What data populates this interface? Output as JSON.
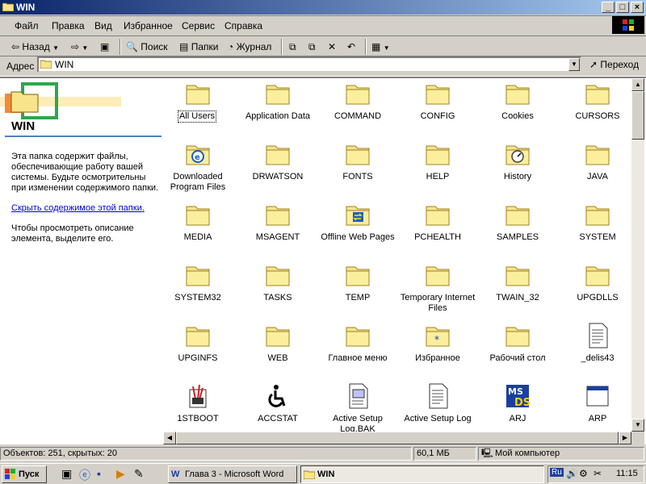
{
  "window": {
    "title": "WIN",
    "min": "_",
    "max": "□",
    "close": "×"
  },
  "menu": {
    "items": [
      {
        "label": "Файл"
      },
      {
        "label": "Правка"
      },
      {
        "label": "Вид"
      },
      {
        "label": "Избранное"
      },
      {
        "label": "Сервис"
      },
      {
        "label": "Справка"
      }
    ]
  },
  "toolbar": {
    "back": "Назад",
    "search": "Поиск",
    "folders": "Папки",
    "journal": "Журнал"
  },
  "address": {
    "label": "Адрес",
    "value": "WIN",
    "go": "Переход"
  },
  "leftpane": {
    "title": "WIN",
    "description": "Эта папка содержит файлы, обеспечивающие работу вашей системы. Будьте осмотрительны при изменении содержимого папки.",
    "hide_link": "Скрыть содержимое этой папки",
    "hide_link_suffix": ".",
    "select_info": "Чтобы просмотреть описание элемента, выделите его."
  },
  "items": [
    {
      "label": "All Users",
      "icon": "folder-icon"
    },
    {
      "label": "Application Data",
      "icon": "folder-icon"
    },
    {
      "label": "COMMAND",
      "icon": "folder-icon"
    },
    {
      "label": "CONFIG",
      "icon": "folder-icon"
    },
    {
      "label": "Cookies",
      "icon": "folder-icon"
    },
    {
      "label": "CURSORS",
      "icon": "folder-icon"
    },
    {
      "label": "Downloaded Program Files",
      "icon": "ie-folder-icon"
    },
    {
      "label": "DRWATSON",
      "icon": "folder-icon"
    },
    {
      "label": "FONTS",
      "icon": "folder-icon"
    },
    {
      "label": "HELP",
      "icon": "folder-icon"
    },
    {
      "label": "History",
      "icon": "history-folder-icon"
    },
    {
      "label": "JAVA",
      "icon": "folder-icon"
    },
    {
      "label": "MEDIA",
      "icon": "folder-icon"
    },
    {
      "label": "MSAGENT",
      "icon": "folder-icon"
    },
    {
      "label": "Offline Web Pages",
      "icon": "offline-folder-icon"
    },
    {
      "label": "PCHEALTH",
      "icon": "folder-icon"
    },
    {
      "label": "SAMPLES",
      "icon": "folder-icon"
    },
    {
      "label": "SYSTEM",
      "icon": "folder-icon"
    },
    {
      "label": "SYSTEM32",
      "icon": "folder-icon"
    },
    {
      "label": "TASKS",
      "icon": "folder-icon"
    },
    {
      "label": "TEMP",
      "icon": "folder-icon"
    },
    {
      "label": "Temporary Internet Files",
      "icon": "folder-icon"
    },
    {
      "label": "TWAIN_32",
      "icon": "folder-icon"
    },
    {
      "label": "UPGDLLS",
      "icon": "folder-icon"
    },
    {
      "label": "UPGINFS",
      "icon": "folder-icon"
    },
    {
      "label": "WEB",
      "icon": "folder-icon"
    },
    {
      "label": "Главное меню",
      "icon": "folder-icon"
    },
    {
      "label": "Избранное",
      "icon": "favorites-folder-icon"
    },
    {
      "label": "Рабочий стол",
      "icon": "folder-icon"
    },
    {
      "label": "_delis43",
      "icon": "text-file-icon"
    },
    {
      "label": "1STBOOT",
      "icon": "tools-icon"
    },
    {
      "label": "ACCSTAT",
      "icon": "accessibility-icon"
    },
    {
      "label": "Active Setup Log.BAK",
      "icon": "bak-file-icon"
    },
    {
      "label": "Active Setup Log",
      "icon": "text-file-icon"
    },
    {
      "label": "ARJ",
      "icon": "msdos-icon"
    },
    {
      "label": "ARP",
      "icon": "window-icon"
    }
  ],
  "status": {
    "objects": "Объектов: 251, скрытых: 20",
    "size": "60,1 МБ",
    "location": "Мой компьютер"
  },
  "taskbar": {
    "start": "Пуск",
    "tasks": [
      {
        "label": "Глава 3 - Microsoft Word"
      },
      {
        "label": "WIN"
      }
    ],
    "lang": "Ru",
    "clock": "11:15"
  },
  "colors": {
    "titlebar": "#0a246a",
    "folder": "#f7e48b",
    "link": "#0000ee"
  }
}
